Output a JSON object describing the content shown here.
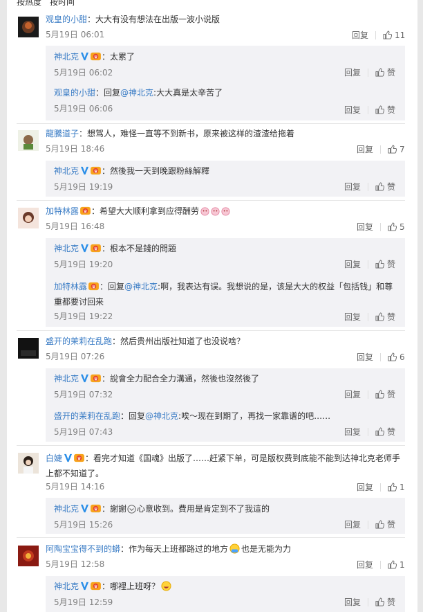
{
  "sort_tabs": [
    "按热度",
    "按时间"
  ],
  "labels": {
    "reply": "回复",
    "like": "赞"
  },
  "comments": [
    {
      "user": "观皇的小甜",
      "text": "：大大有没有想法在出版一波小说版",
      "date": "5月19日 06:01",
      "likes": "11",
      "replies": [
        {
          "user": "神北克",
          "text": "：太累了",
          "date": "5月19日 06:02"
        },
        {
          "user": "观皇的小甜",
          "text": "：回复",
          "mention": "@神北克",
          "text2": ":大大真是太辛苦了",
          "date": "5月19日 06:06"
        }
      ]
    },
    {
      "user": "龍騰道子",
      "text": "：想驾人，难怪一直等不到新书，原来被这样的渣渣给拖着",
      "date": "5月19日 18:46",
      "likes": "7",
      "replies": [
        {
          "user": "神北克",
          "text": "：然後我一天到晚跟粉絲解釋",
          "date": "5月19日 19:19"
        }
      ]
    },
    {
      "user": "加特林露",
      "text": "：希望大大顺利拿到应得酬劳",
      "date": "5月19日 16:48",
      "likes": "5",
      "replies": [
        {
          "user": "神北克",
          "text": "：根本不是錢的問題",
          "date": "5月19日 19:20"
        },
        {
          "user": "加特林露",
          "text": "：回复",
          "mention": "@神北克",
          "text2": ":啊，我表达有误。我想说的是，该是大大的权益「包括钱」和尊重都要讨回来",
          "date": "5月19日 19:22"
        }
      ]
    },
    {
      "user": "盛开的茉莉在乱跑",
      "text": "：然后贵州出版社知道了也没说啥？",
      "date": "5月19日 07:26",
      "likes": "6",
      "replies": [
        {
          "user": "神北克",
          "text": "：說會全力配合全力溝通，然後也沒然後了",
          "date": "5月19日 07:32"
        },
        {
          "user": "盛开的茉莉在乱跑",
          "text": "：回复",
          "mention": "@神北克",
          "text2": ":唉～现在到期了，再找一家靠谱的吧……",
          "date": "5月19日 07:43"
        }
      ]
    },
    {
      "user": "白婕",
      "text": "：看完才知道《国魂》出版了……赶紧下单，可是版权费到底能不能到达神北克老师手上都不知道了。",
      "date": "5月19日 14:16",
      "likes": "1",
      "replies": [
        {
          "user": "神北克",
          "text": "：謝謝",
          "text2": "心意收到。費用是肯定到不了我這的",
          "date": "5月19日 15:26"
        }
      ]
    },
    {
      "user": "阿陶宝宝得不到的蟒",
      "text": "：作为每天上班都路过的地方",
      "text2": "也是无能为力",
      "date": "5月19日 12:58",
      "likes": "1",
      "replies": [
        {
          "user": "神北克",
          "text": "：哪裡上班呀？",
          "date": "5月19日 12:59"
        }
      ]
    }
  ]
}
